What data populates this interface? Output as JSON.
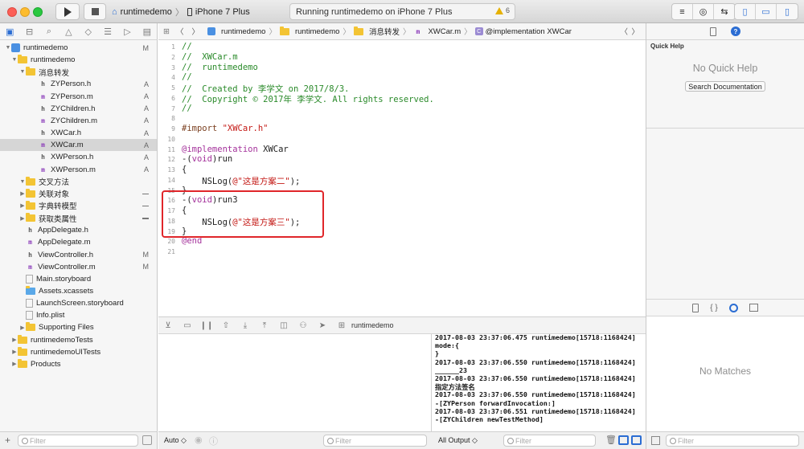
{
  "window": {
    "scheme": "runtimedemo",
    "device": "iPhone 7 Plus",
    "activity": "Running runtimedemo on iPhone 7 Plus",
    "warnings": "6"
  },
  "navigator": {
    "rows": [
      {
        "label": "runtimedemo",
        "status": "M",
        "level": 0,
        "type": "project",
        "open": true
      },
      {
        "label": "runtimedemo",
        "status": "",
        "level": 1,
        "type": "folder",
        "open": true
      },
      {
        "label": "消息转发",
        "status": "",
        "level": 2,
        "type": "folder",
        "open": true
      },
      {
        "label": "ZYPerson.h",
        "status": "A",
        "level": 3,
        "type": "h"
      },
      {
        "label": "ZYPerson.m",
        "status": "A",
        "level": 3,
        "type": "m"
      },
      {
        "label": "ZYChildren.h",
        "status": "A",
        "level": 3,
        "type": "h"
      },
      {
        "label": "ZYChildren.m",
        "status": "A",
        "level": 3,
        "type": "m"
      },
      {
        "label": "XWCar.h",
        "status": "A",
        "level": 3,
        "type": "h"
      },
      {
        "label": "XWCar.m",
        "status": "A",
        "level": 3,
        "type": "m",
        "selected": true
      },
      {
        "label": "XWPerson.h",
        "status": "A",
        "level": 3,
        "type": "h"
      },
      {
        "label": "XWPerson.m",
        "status": "A",
        "level": 3,
        "type": "m"
      },
      {
        "label": "交叉方法",
        "status": "",
        "level": 2,
        "type": "folder",
        "open": true
      },
      {
        "label": "关联对象",
        "status": "dash",
        "level": 2,
        "type": "folder",
        "open": false
      },
      {
        "label": "字典转模型",
        "status": "dash",
        "level": 2,
        "type": "folder",
        "open": false
      },
      {
        "label": "获取类属性",
        "status": "dash",
        "level": 2,
        "type": "folder",
        "open": false
      },
      {
        "label": "AppDelegate.h",
        "status": "",
        "level": 2,
        "type": "h"
      },
      {
        "label": "AppDelegate.m",
        "status": "",
        "level": 2,
        "type": "m"
      },
      {
        "label": "ViewController.h",
        "status": "M",
        "level": 2,
        "type": "h"
      },
      {
        "label": "ViewController.m",
        "status": "M",
        "level": 2,
        "type": "m"
      },
      {
        "label": "Main.storyboard",
        "status": "",
        "level": 2,
        "type": "sb"
      },
      {
        "label": "Assets.xcassets",
        "status": "",
        "level": 2,
        "type": "assets"
      },
      {
        "label": "LaunchScreen.storyboard",
        "status": "",
        "level": 2,
        "type": "sb"
      },
      {
        "label": "Info.plist",
        "status": "",
        "level": 2,
        "type": "plist"
      },
      {
        "label": "Supporting Files",
        "status": "",
        "level": 2,
        "type": "folder",
        "open": false
      },
      {
        "label": "runtimedemoTests",
        "status": "",
        "level": 1,
        "type": "folder",
        "open": false
      },
      {
        "label": "runtimedemoUITests",
        "status": "",
        "level": 1,
        "type": "folder",
        "open": false
      },
      {
        "label": "Products",
        "status": "",
        "level": 1,
        "type": "folder",
        "open": false
      }
    ],
    "filter_placeholder": "Filter"
  },
  "jumpbar": {
    "crumbs": [
      "runtimedemo",
      "runtimedemo",
      "消息转发",
      "XWCar.m",
      "@implementation XWCar"
    ]
  },
  "editor": {
    "lines": [
      {
        "n": "1",
        "t": "//",
        "c": "cm"
      },
      {
        "n": "2",
        "t": "//  XWCar.m",
        "c": "cm"
      },
      {
        "n": "3",
        "t": "//  runtimedemo",
        "c": "cm"
      },
      {
        "n": "4",
        "t": "//",
        "c": "cm"
      },
      {
        "n": "5",
        "t": "//  Created by 李学文 on 2017/8/3.",
        "c": "cm"
      },
      {
        "n": "6",
        "t": "//  Copyright © 2017年 李学文. All rights reserved.",
        "c": "cm"
      },
      {
        "n": "7",
        "t": "//",
        "c": "cm"
      },
      {
        "n": "8",
        "t": "",
        "c": ""
      },
      {
        "n": "9",
        "t": "#import \"XWCar.h\"",
        "c": "import"
      },
      {
        "n": "10",
        "t": "",
        "c": ""
      },
      {
        "n": "11",
        "t": "@implementation XWCar",
        "c": "impl"
      },
      {
        "n": "12",
        "t": "-(void)run",
        "c": "method"
      },
      {
        "n": "13",
        "t": "{",
        "c": ""
      },
      {
        "n": "14",
        "t": "    NSLog(@\"这是方案二\");",
        "c": "log"
      },
      {
        "n": "15",
        "t": "}",
        "c": ""
      },
      {
        "n": "16",
        "t": "-(void)run3",
        "c": "method"
      },
      {
        "n": "17",
        "t": "{",
        "c": ""
      },
      {
        "n": "18",
        "t": "    NSLog(@\"这是方案三\");",
        "c": "log"
      },
      {
        "n": "19",
        "t": "}",
        "c": ""
      },
      {
        "n": "20",
        "t": "@end",
        "c": "kw"
      },
      {
        "n": "21",
        "t": "",
        "c": ""
      }
    ]
  },
  "debug": {
    "process": "runtimedemo",
    "auto_label": "Auto ◇",
    "output_label": "All Output ◇",
    "filter_placeholder": "Filter",
    "console_lines": [
      "2017-08-03 23:37:06.475 runtimedemo[15718:1168424]",
      "mode:{",
      "}",
      "2017-08-03 23:37:06.550 runtimedemo[15718:1168424]",
      "______23",
      "2017-08-03 23:37:06.550 runtimedemo[15718:1168424]",
      "指定方法签名",
      "2017-08-03 23:37:06.550 runtimedemo[15718:1168424]",
      "-[ZYPerson forwardInvocation:]",
      "2017-08-03 23:37:06.551 runtimedemo[15718:1168424]",
      "-[ZYChildren newTestMethod]"
    ]
  },
  "inspector": {
    "title": "Quick Help",
    "no_help": "No Quick Help",
    "search_button": "Search Documentation",
    "no_matches": "No Matches",
    "filter_placeholder": "Filter"
  },
  "colors": {
    "comment": "#2a8a2a",
    "keyword": "#a4329b",
    "string": "#c41a16",
    "highlight_box": "#e0262a"
  }
}
